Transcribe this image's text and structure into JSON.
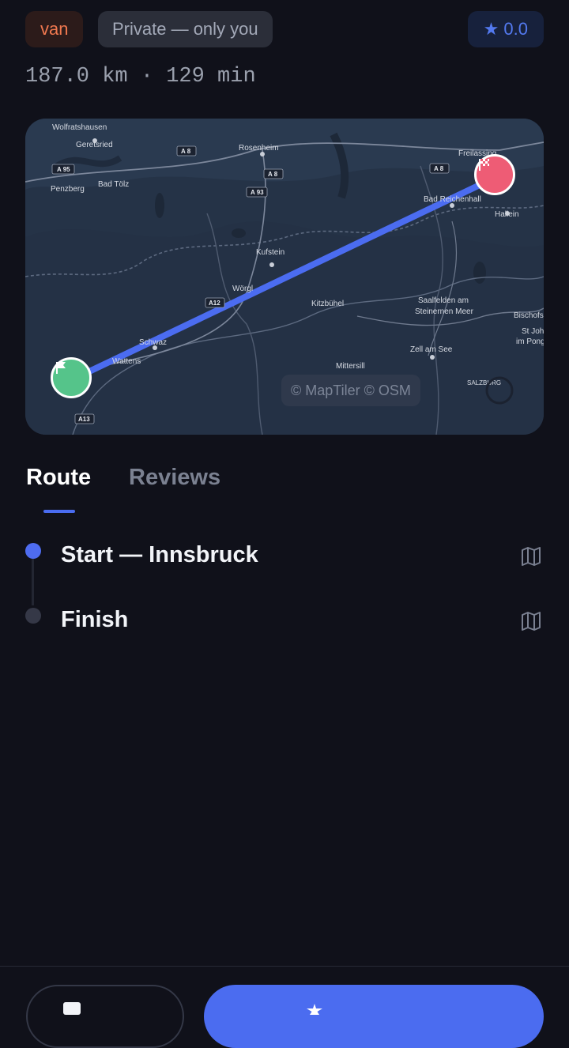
{
  "header": {
    "vehicle_badge": "van",
    "visibility_badge": "Private — only you",
    "rating_badge": "★ 0.0"
  },
  "route_stats": "187.0 km · 129 min",
  "map": {
    "attribution": "© MapTiler © OSM",
    "place_labels": [
      "Wolfratshausen",
      "Geretsried",
      "Rosenheim",
      "Freilassing",
      "Penzberg",
      "Bad Tölz",
      "Bad Reichenhall",
      "Hallein",
      "Kufstein",
      "Wörgl",
      "Kitzbühel",
      "Saalfelden am",
      "Steinernen Meer",
      "Bischofs",
      "St Joha",
      "im Pong",
      "Schwaz",
      "Wattens",
      "Zell am See",
      "Mittersill",
      "SALZBURG"
    ],
    "road_labels": [
      "A 95",
      "A 8",
      "A 8",
      "A 8",
      "A 93",
      "A12",
      "A13"
    ]
  },
  "tabs": [
    {
      "label": "Route",
      "active": true
    },
    {
      "label": "Reviews",
      "active": false
    }
  ],
  "stops": [
    {
      "label": "Start — Innsbruck"
    },
    {
      "label": "Finish"
    }
  ],
  "colors": {
    "accent": "#4b6cf0",
    "start_marker": "#55c48a",
    "finish_marker": "#ee5c75",
    "background": "#10111a"
  }
}
